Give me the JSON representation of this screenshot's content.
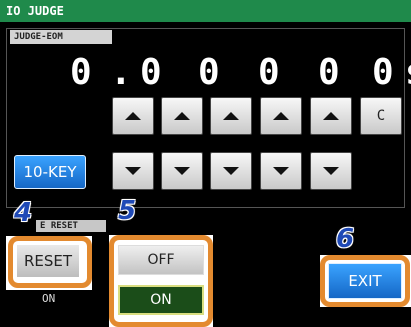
{
  "window": {
    "title": "IO JUDGE"
  },
  "tab": {
    "label": "JUDGE-EOM"
  },
  "value": {
    "digits": [
      "0",
      ".",
      "0",
      "0",
      "0",
      "0",
      "0",
      "s"
    ]
  },
  "buttons": {
    "clear": "C",
    "tenkey": "10-KEY",
    "reset": "RESET",
    "off": "OFF",
    "on": "ON",
    "exit": "EXIT"
  },
  "section": {
    "reset_title": "E RESET",
    "current_value": "ON"
  },
  "callouts": [
    "4",
    "5",
    "6"
  ],
  "colors": {
    "titlebar": "#1f8a4b",
    "accent": "#e38a2f",
    "blue": "#1567c6"
  }
}
